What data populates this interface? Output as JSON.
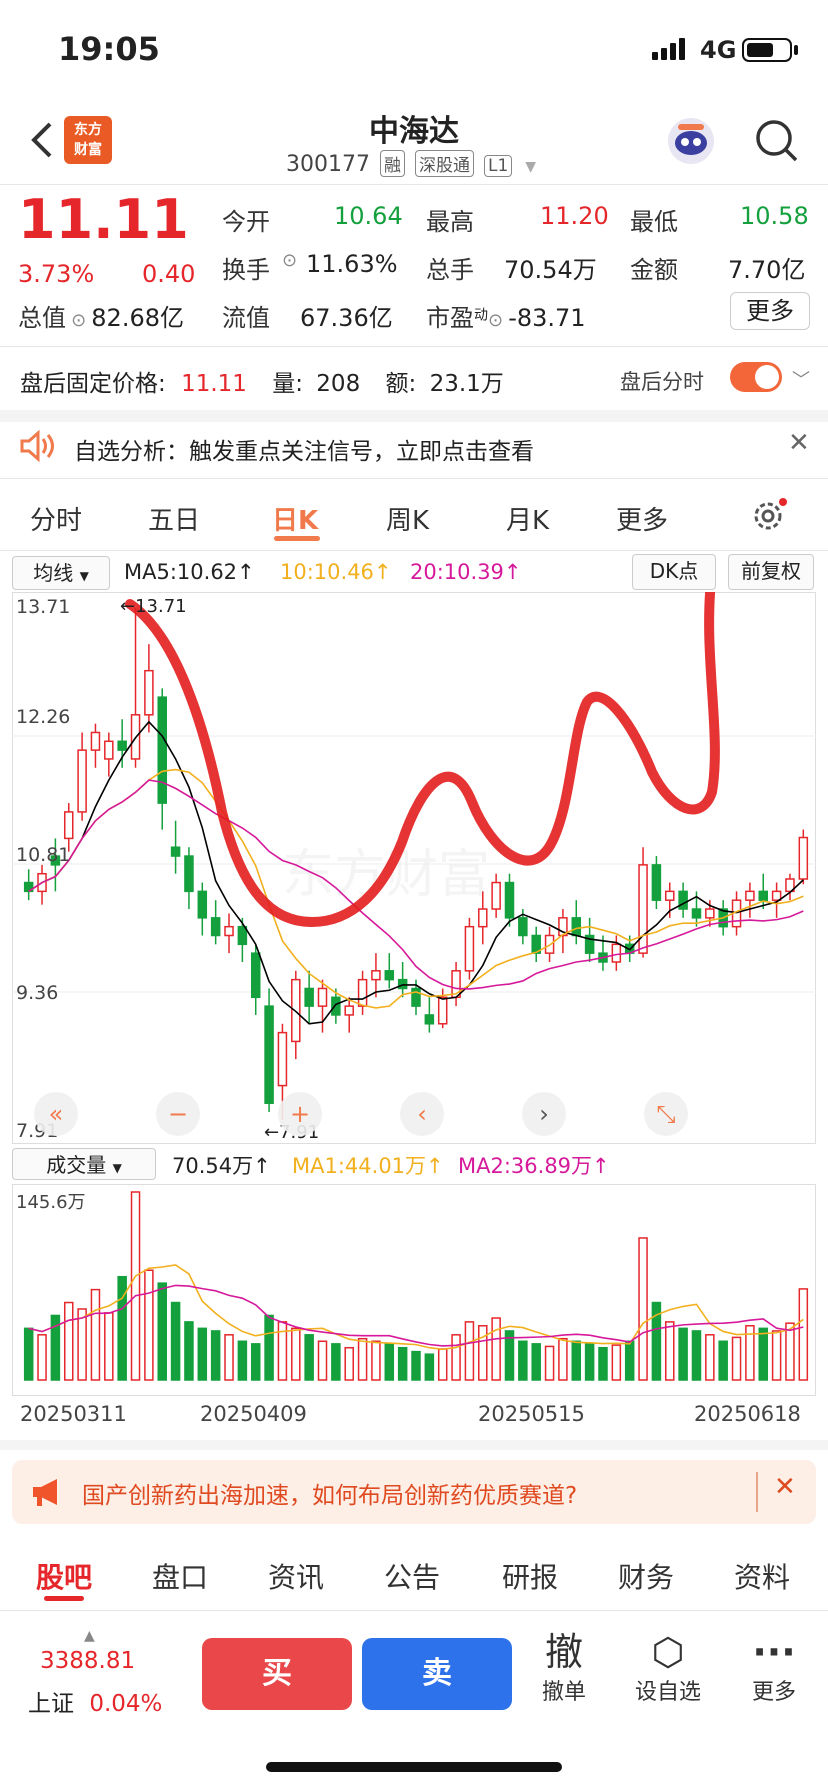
{
  "status": {
    "time": "19:05",
    "network": "4G"
  },
  "header": {
    "logo_line1": "东方",
    "logo_line2": "财富",
    "title": "中海达",
    "code": "300177",
    "tags": [
      "融",
      "深股通",
      "L1"
    ]
  },
  "quote": {
    "price": "11.11",
    "change_pct": "3.73%",
    "change": "0.40",
    "open_label": "今开",
    "open": "10.64",
    "high_label": "最高",
    "high": "11.20",
    "low_label": "最低",
    "low": "10.58",
    "turnover_label": "换手",
    "turnover": "11.63%",
    "volume_label": "总手",
    "volume": "70.54万",
    "amount_label": "金额",
    "amount": "7.70亿",
    "mktcap_label": "总值",
    "mktcap": "82.68亿",
    "float_label": "流值",
    "float": "67.36亿",
    "pe_label": "市盈",
    "pe_sup": "动",
    "pe": "-83.71",
    "more": "更多"
  },
  "afterhours": {
    "label": "盘后固定价格:",
    "price": "11.11",
    "vol_label": "量:",
    "vol": "208",
    "amt_label": "额:",
    "amt": "23.1万",
    "toggle_label": "盘后分时"
  },
  "notice": {
    "text": "自选分析：触发重点关注信号，立即点击查看"
  },
  "tabs": [
    "分时",
    "五日",
    "日K",
    "周K",
    "月K",
    "更多"
  ],
  "active_tab": "日K",
  "kline": {
    "indicator": "均线",
    "ma5": "MA5:10.62",
    "ma10": "10:10.46",
    "ma20": "20:10.39",
    "dk_button": "DK点",
    "adjust_button": "前复权",
    "watermark": "东方财富",
    "ylabels": [
      "13.71",
      "12.26",
      "10.81",
      "9.36",
      "7.91"
    ],
    "max_mark": "13.71",
    "min_mark": "7.91"
  },
  "volume": {
    "indicator": "成交量",
    "value": "70.54万",
    "ma1": "MA1:44.01万",
    "ma2": "MA2:36.89万",
    "max_label": "145.6万",
    "dates": [
      "20250311",
      "20250409",
      "20250515",
      "20250618"
    ]
  },
  "colors": {
    "up": "#e5262a",
    "down": "#13a03d",
    "accent": "#f3663a",
    "ma5": "#000000",
    "ma10": "#f2b01e",
    "ma20": "#d6199a",
    "annotation": "#e31d1d"
  },
  "chart_data": {
    "type": "candlestick",
    "title": "",
    "ylim": [
      7.91,
      13.71
    ],
    "x_ticks": [
      "20250311",
      "20250409",
      "20250515",
      "20250618"
    ],
    "ohlc": [
      [
        10.6,
        10.75,
        10.4,
        10.5
      ],
      [
        10.5,
        10.8,
        10.35,
        10.7
      ],
      [
        10.9,
        11.1,
        10.5,
        10.8
      ],
      [
        11.1,
        11.5,
        10.95,
        11.4
      ],
      [
        11.4,
        12.3,
        11.3,
        12.1
      ],
      [
        12.1,
        12.4,
        11.9,
        12.3
      ],
      [
        12.0,
        12.3,
        11.8,
        12.2
      ],
      [
        12.2,
        12.45,
        11.9,
        12.1
      ],
      [
        12.0,
        13.71,
        11.9,
        12.5
      ],
      [
        12.5,
        13.3,
        12.3,
        13.0
      ],
      [
        12.7,
        12.8,
        11.2,
        11.5
      ],
      [
        11.0,
        11.3,
        10.7,
        10.9
      ],
      [
        10.9,
        11.0,
        10.3,
        10.5
      ],
      [
        10.5,
        10.6,
        10.0,
        10.2
      ],
      [
        10.2,
        10.4,
        9.9,
        10.0
      ],
      [
        10.0,
        10.25,
        9.8,
        10.1
      ],
      [
        10.1,
        10.2,
        9.7,
        9.9
      ],
      [
        9.8,
        9.9,
        9.1,
        9.3
      ],
      [
        9.2,
        9.4,
        8.0,
        8.1
      ],
      [
        8.3,
        9.0,
        7.91,
        8.9
      ],
      [
        8.8,
        9.6,
        8.6,
        9.5
      ],
      [
        9.4,
        9.6,
        9.0,
        9.2
      ],
      [
        9.2,
        9.5,
        8.9,
        9.4
      ],
      [
        9.3,
        9.4,
        9.0,
        9.1
      ],
      [
        9.1,
        9.3,
        8.9,
        9.2
      ],
      [
        9.2,
        9.6,
        9.1,
        9.5
      ],
      [
        9.5,
        9.8,
        9.3,
        9.6
      ],
      [
        9.6,
        9.8,
        9.4,
        9.5
      ],
      [
        9.5,
        9.7,
        9.3,
        9.4
      ],
      [
        9.4,
        9.5,
        9.1,
        9.2
      ],
      [
        9.1,
        9.3,
        8.9,
        9.0
      ],
      [
        9.0,
        9.4,
        8.95,
        9.3
      ],
      [
        9.3,
        9.7,
        9.2,
        9.6
      ],
      [
        9.6,
        10.2,
        9.5,
        10.1
      ],
      [
        10.1,
        10.5,
        9.9,
        10.3
      ],
      [
        10.3,
        10.7,
        10.2,
        10.6
      ],
      [
        10.6,
        10.7,
        10.1,
        10.2
      ],
      [
        10.2,
        10.3,
        9.9,
        10.0
      ],
      [
        10.0,
        10.1,
        9.7,
        9.8
      ],
      [
        9.8,
        10.1,
        9.7,
        10.0
      ],
      [
        10.0,
        10.3,
        9.8,
        10.2
      ],
      [
        10.2,
        10.4,
        9.9,
        10.0
      ],
      [
        10.0,
        10.2,
        9.7,
        9.8
      ],
      [
        9.8,
        10.0,
        9.6,
        9.7
      ],
      [
        9.7,
        10.0,
        9.6,
        9.9
      ],
      [
        9.9,
        10.0,
        9.7,
        9.8
      ],
      [
        9.8,
        11.0,
        9.75,
        10.8
      ],
      [
        10.8,
        10.9,
        10.3,
        10.4
      ],
      [
        10.4,
        10.6,
        10.2,
        10.5
      ],
      [
        10.5,
        10.6,
        10.2,
        10.3
      ],
      [
        10.3,
        10.5,
        10.1,
        10.2
      ],
      [
        10.2,
        10.4,
        10.1,
        10.3
      ],
      [
        10.3,
        10.4,
        10.0,
        10.1
      ],
      [
        10.1,
        10.5,
        10.0,
        10.4
      ],
      [
        10.4,
        10.6,
        10.2,
        10.5
      ],
      [
        10.5,
        10.7,
        10.3,
        10.4
      ],
      [
        10.4,
        10.6,
        10.2,
        10.5
      ],
      [
        10.5,
        10.7,
        10.4,
        10.64
      ],
      [
        10.64,
        11.2,
        10.58,
        11.11
      ]
    ],
    "volume": [
      40,
      35,
      50,
      60,
      55,
      70,
      52,
      80,
      145.6,
      85,
      75,
      60,
      45,
      40,
      38,
      35,
      30,
      28,
      50,
      45,
      40,
      35,
      30,
      28,
      25,
      32,
      30,
      28,
      25,
      22,
      20,
      24,
      35,
      45,
      42,
      48,
      38,
      30,
      28,
      26,
      32,
      30,
      28,
      25,
      27,
      30,
      110,
      60,
      45,
      40,
      38,
      35,
      30,
      33,
      42,
      40,
      38,
      44,
      70.54
    ]
  },
  "banner": {
    "text": "国产创新药出海加速，如何布局创新药优质赛道?"
  },
  "bottom_tabs": [
    "股吧",
    "盘口",
    "资讯",
    "公告",
    "研报",
    "财务",
    "资料"
  ],
  "active_bottom_tab": "股吧",
  "index": {
    "value": "3388.81",
    "name": "上证",
    "change": "0.04%"
  },
  "trade": {
    "buy": "买",
    "sell": "卖"
  },
  "tools": [
    {
      "icon": "撤",
      "label": "撤单"
    },
    {
      "icon": "⬡",
      "label": "设自选"
    },
    {
      "icon": "···",
      "label": "更多"
    }
  ]
}
